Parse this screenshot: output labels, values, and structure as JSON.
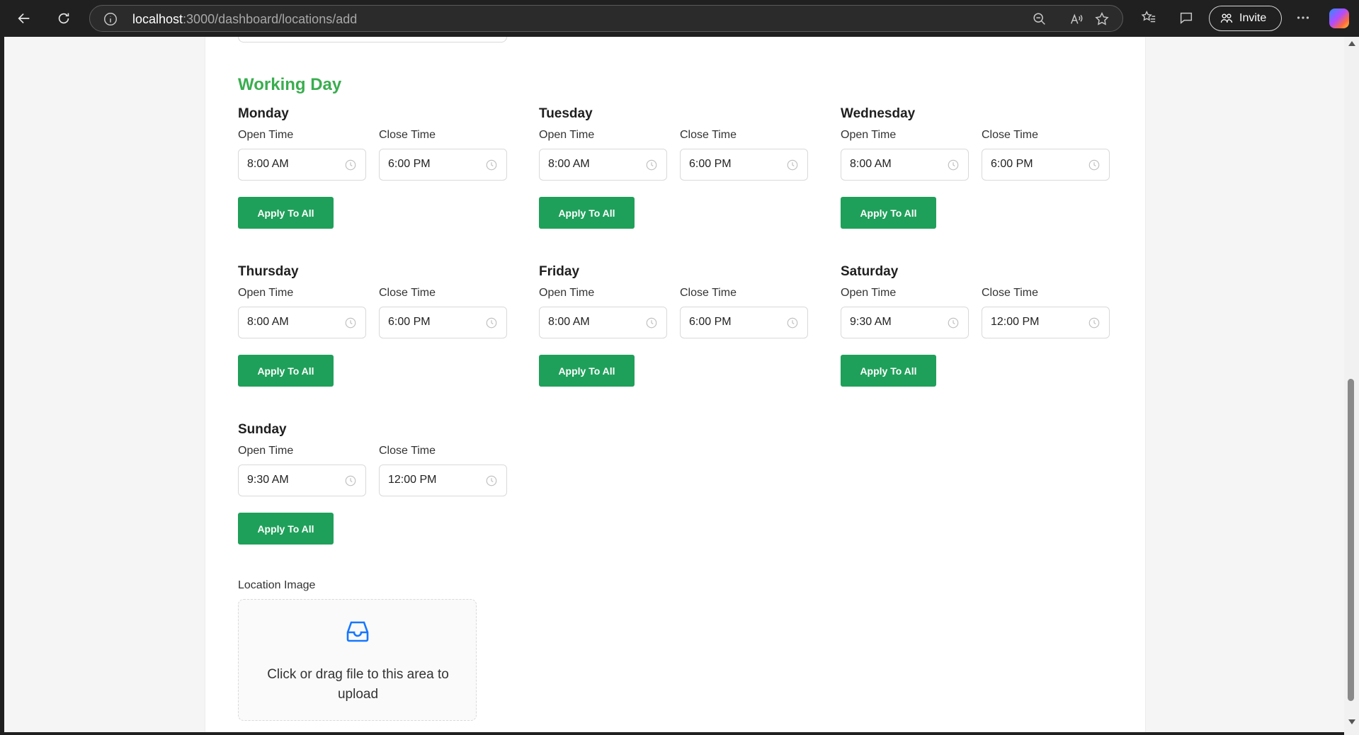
{
  "browser": {
    "url_host": "localhost",
    "url_path": ":3000/dashboard/locations/add",
    "invite_label": "Invite"
  },
  "section": {
    "title": "Working Day"
  },
  "days": [
    {
      "name": "Monday",
      "open_label": "Open Time",
      "close_label": "Close Time",
      "open": "8:00 AM",
      "close": "6:00 PM",
      "apply_label": "Apply To All"
    },
    {
      "name": "Tuesday",
      "open_label": "Open Time",
      "close_label": "Close Time",
      "open": "8:00 AM",
      "close": "6:00 PM",
      "apply_label": "Apply To All"
    },
    {
      "name": "Wednesday",
      "open_label": "Open Time",
      "close_label": "Close Time",
      "open": "8:00 AM",
      "close": "6:00 PM",
      "apply_label": "Apply To All"
    },
    {
      "name": "Thursday",
      "open_label": "Open Time",
      "close_label": "Close Time",
      "open": "8:00 AM",
      "close": "6:00 PM",
      "apply_label": "Apply To All"
    },
    {
      "name": "Friday",
      "open_label": "Open Time",
      "close_label": "Close Time",
      "open": "8:00 AM",
      "close": "6:00 PM",
      "apply_label": "Apply To All"
    },
    {
      "name": "Saturday",
      "open_label": "Open Time",
      "close_label": "Close Time",
      "open": "9:30 AM",
      "close": "12:00 PM",
      "apply_label": "Apply To All"
    },
    {
      "name": "Sunday",
      "open_label": "Open Time",
      "close_label": "Close Time",
      "open": "9:30 AM",
      "close": "12:00 PM",
      "apply_label": "Apply To All"
    }
  ],
  "upload": {
    "label": "Location Image",
    "text": "Click or drag file to this area to upload",
    "icon": "inbox-icon"
  },
  "colors": {
    "accent_green": "#1fa05a",
    "title_green": "#3aad4f",
    "upload_icon_blue": "#1677ff"
  }
}
